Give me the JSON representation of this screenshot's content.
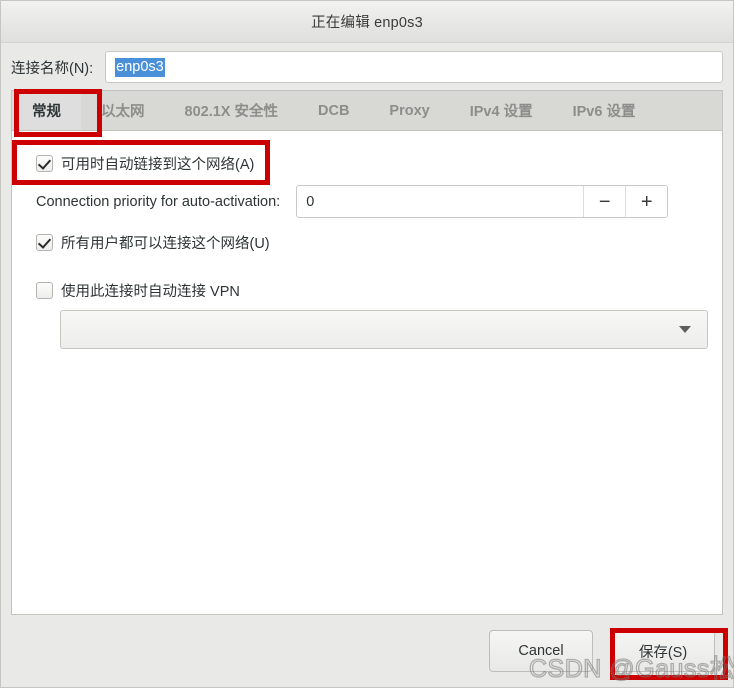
{
  "window": {
    "title": "正在编辑 enp0s3"
  },
  "connection": {
    "name_label": "连接名称(N):",
    "name_value": "enp0s3"
  },
  "tabs": [
    {
      "label": "常规",
      "active": true
    },
    {
      "label": "以太网",
      "active": false
    },
    {
      "label": "802.1X 安全性",
      "active": false
    },
    {
      "label": "DCB",
      "active": false
    },
    {
      "label": "Proxy",
      "active": false
    },
    {
      "label": "IPv4 设置",
      "active": false
    },
    {
      "label": "IPv6 设置",
      "active": false
    }
  ],
  "general": {
    "autoconnect_label": "可用时自动链接到这个网络(A)",
    "autoconnect_checked": true,
    "priority_label": "Connection priority for auto-activation:",
    "priority_value": "0",
    "spin_down": "−",
    "spin_up": "+",
    "all_users_label": "所有用户都可以连接这个网络(U)",
    "all_users_checked": true,
    "vpn_label": "使用此连接时自动连接 VPN",
    "vpn_checked": false,
    "vpn_combo_value": ""
  },
  "actions": {
    "cancel_label": "Cancel",
    "save_label": "保存(S)"
  },
  "watermark": {
    "text": "CSDN @Gauss松鼠会"
  },
  "colors": {
    "annotation": "#cc0000",
    "selection": "#4a90d9",
    "dialog_bg": "#e9e9e7",
    "pane_bg": "#ffffff"
  }
}
